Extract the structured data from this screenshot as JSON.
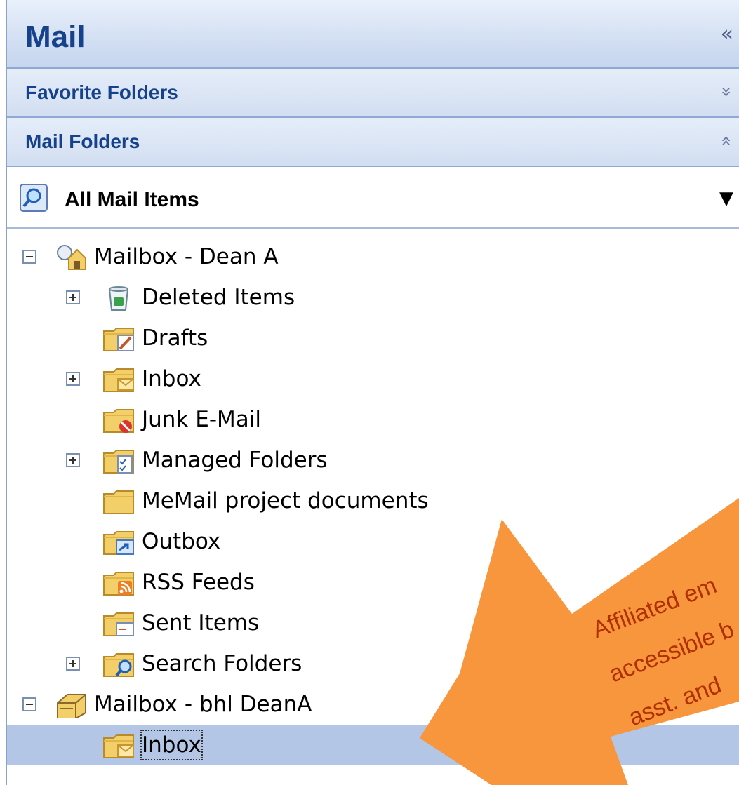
{
  "header": {
    "title": "Mail",
    "collapse_glyph": "«"
  },
  "sections": {
    "favorite": {
      "label": "Favorite Folders",
      "chevron": "»"
    },
    "mail": {
      "label": "Mail Folders",
      "chevron": "«"
    }
  },
  "view": {
    "label": "All Mail Items",
    "icon": "search-icon",
    "dropdown_glyph": "▼"
  },
  "tree": [
    {
      "label": "Mailbox - Dean A",
      "icon": "mailbox-home-icon",
      "toggle": "minus"
    },
    {
      "label": "Deleted Items",
      "icon": "recycle-bin-icon",
      "toggle": "plus"
    },
    {
      "label": "Drafts",
      "icon": "drafts-folder-icon",
      "toggle": ""
    },
    {
      "label": "Inbox",
      "icon": "inbox-folder-icon",
      "toggle": "plus"
    },
    {
      "label": "Junk E-Mail",
      "icon": "junk-folder-icon",
      "toggle": ""
    },
    {
      "label": "Managed Folders",
      "icon": "managed-folder-icon",
      "toggle": "plus"
    },
    {
      "label": "MeMail project documents",
      "icon": "folder-icon",
      "toggle": ""
    },
    {
      "label": "Outbox",
      "icon": "outbox-folder-icon",
      "toggle": ""
    },
    {
      "label": "RSS Feeds",
      "icon": "rss-folder-icon",
      "toggle": ""
    },
    {
      "label": "Sent Items",
      "icon": "sent-folder-icon",
      "toggle": ""
    },
    {
      "label": "Search Folders",
      "icon": "search-folder-icon",
      "toggle": "plus"
    },
    {
      "label": "Mailbox - bhl DeanA",
      "icon": "mailbox-icon",
      "toggle": "minus"
    },
    {
      "label": "Inbox",
      "icon": "inbox-folder-icon",
      "toggle": "",
      "selected": true
    }
  ],
  "callout": {
    "lines": [
      "Affiliated em",
      "accessible b",
      "asst. and "
    ],
    "color": "#f7963c"
  },
  "colors": {
    "header_text": "#15428b",
    "selection": "#b3c6e6",
    "folder_yellow": "#f3cf6a"
  }
}
